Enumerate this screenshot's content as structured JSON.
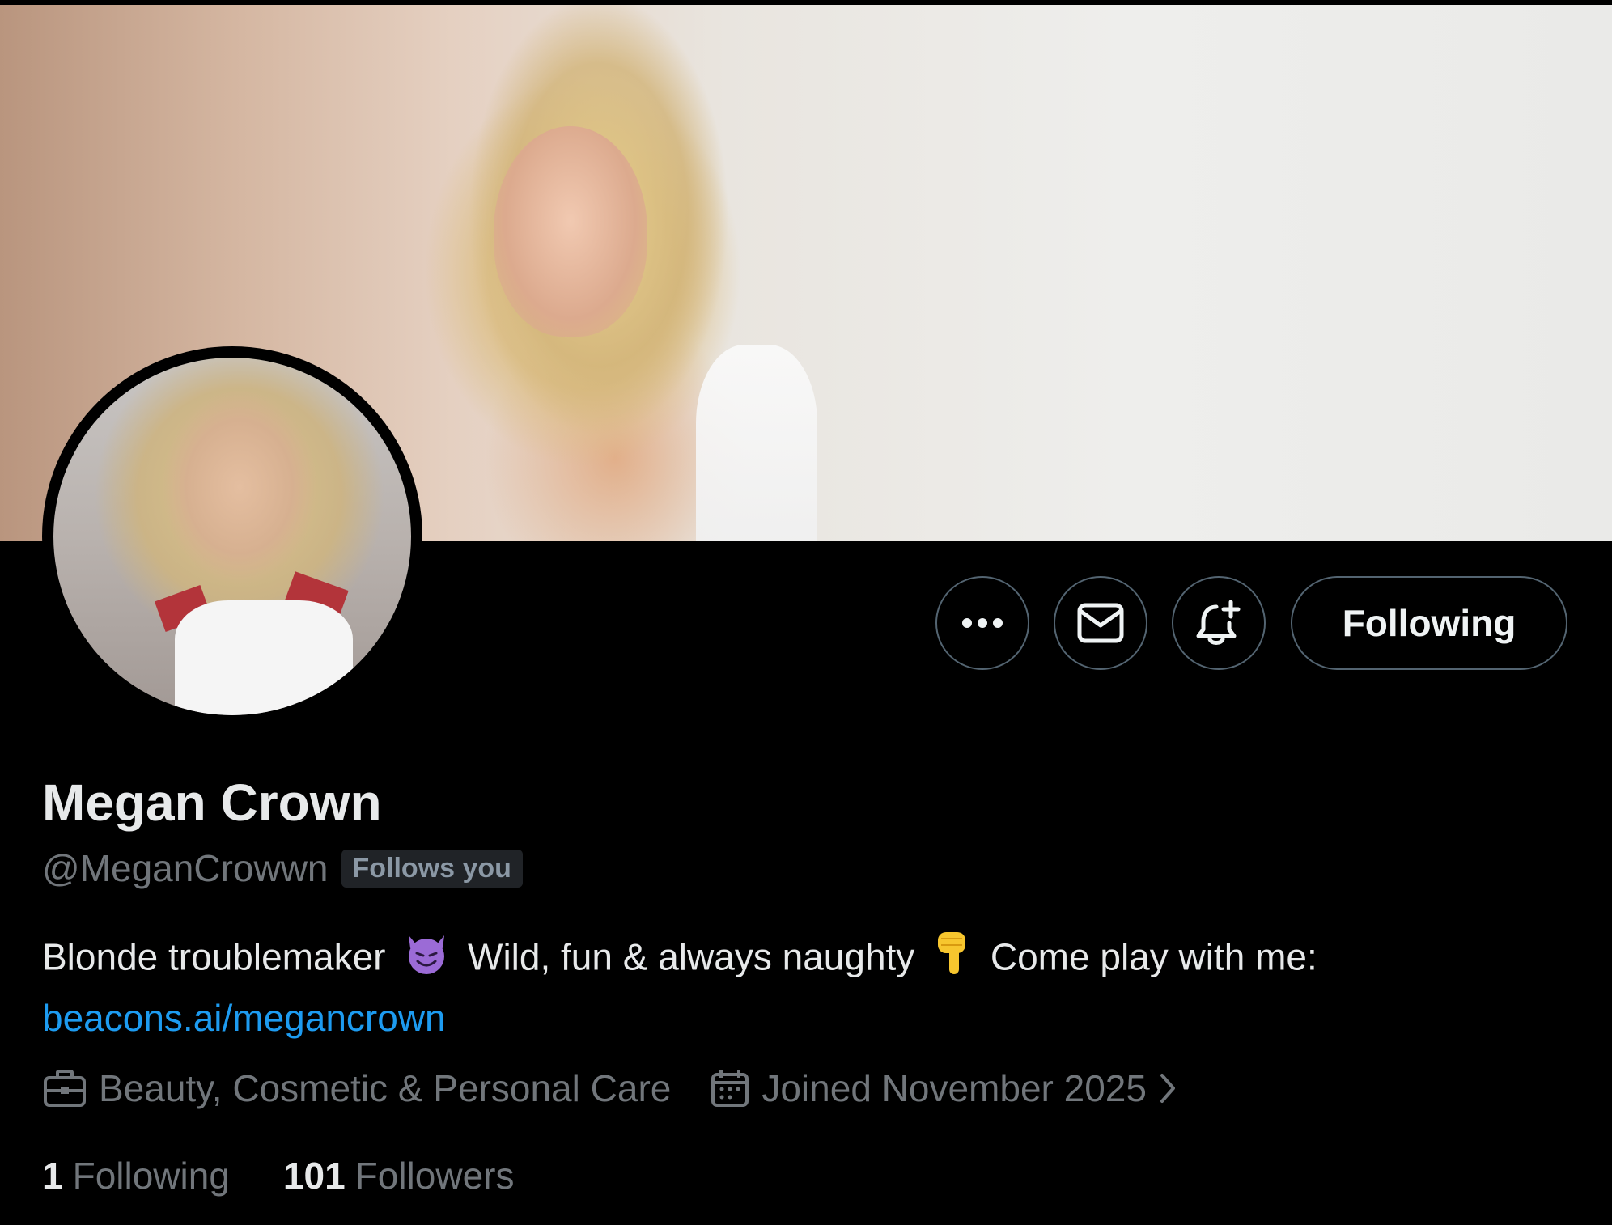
{
  "profile": {
    "display_name": "Megan Crown",
    "handle": "@MeganCrowwn",
    "follows_you": "Follows you",
    "bio_text_1": "Blonde troublemaker",
    "bio_emoji_1": "😈",
    "bio_text_2": "Wild, fun & always naughty",
    "bio_emoji_2": "👇",
    "bio_text_3": "Come play with me:",
    "bio_link": "beacons.ai/megancrown",
    "category": "Beauty, Cosmetic & Personal Care",
    "joined": "Joined November 2025"
  },
  "actions": {
    "more_icon": "more-horizontal-icon",
    "message_icon": "envelope-icon",
    "notify_icon": "bell-plus-icon",
    "following_label": "Following"
  },
  "stats": {
    "following_count": "1",
    "following_label": "Following",
    "followers_count": "101",
    "followers_label": "Followers"
  },
  "colors": {
    "background": "#000000",
    "link": "#1d9bf0",
    "secondary_text": "#71767b",
    "border": "#536471"
  }
}
